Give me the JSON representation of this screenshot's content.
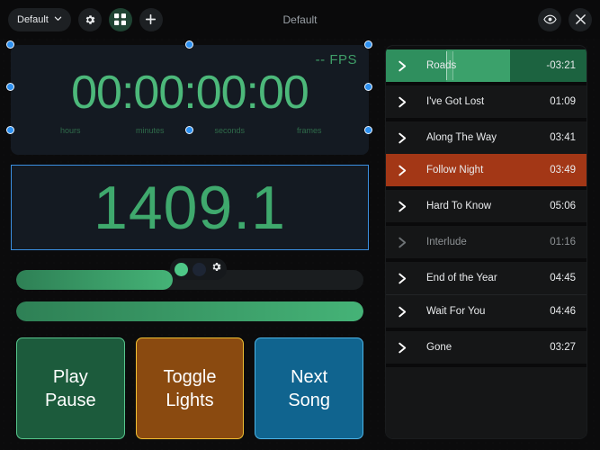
{
  "window": {
    "title": "Default"
  },
  "topbar": {
    "preset_label": "Default",
    "preset_chevron_icon": "chevron-down-icon",
    "settings_icon": "gear-icon",
    "grid_icon": "grid-icon",
    "add_icon": "plus-icon",
    "preview_icon": "eye-icon",
    "close_icon": "close-icon"
  },
  "timecode": {
    "fps_label": "-- FPS",
    "value": "00:00:00:00",
    "units": [
      "hours",
      "minutes",
      "seconds",
      "frames"
    ]
  },
  "value_display": {
    "value": "1409.1",
    "selected": true
  },
  "sliders": [
    {
      "name": "slider-primary",
      "percent": 45
    },
    {
      "name": "slider-secondary",
      "percent": 100
    }
  ],
  "slider_popup": {
    "swatch_green": "#4ec787",
    "swatch_dark": "#1d2534",
    "settings_icon": "gear-icon"
  },
  "buttons": [
    {
      "line1": "Play",
      "line2": "Pause",
      "bg": "#1c5b3c",
      "border": "#57c68d"
    },
    {
      "line1": "Toggle",
      "line2": "Lights",
      "bg": "#8a4a10",
      "border": "#f0c033"
    },
    {
      "line1": "Next",
      "line2": "Song",
      "bg": "#10648f",
      "border": "#4db5e8"
    }
  ],
  "playlist": {
    "tracks": [
      {
        "name": "Roads",
        "time": "-03:21",
        "state": "playing",
        "progress_pct": 30,
        "mid_start_pct": 30,
        "mid_end_pct": 62,
        "cursor_pct": 30
      },
      {
        "name": "I've Got Lost",
        "time": "01:09",
        "state": "normal"
      },
      {
        "name": "Along The Way",
        "time": "03:41",
        "state": "normal"
      },
      {
        "name": "Follow Night",
        "time": "03:49",
        "state": "selected"
      },
      {
        "name": "Hard To Know",
        "time": "05:06",
        "state": "normal"
      },
      {
        "name": "Interlude",
        "time": "01:16",
        "state": "dim"
      },
      {
        "name": "End of the Year",
        "time": "04:45",
        "state": "normal"
      },
      {
        "name": "Wait For You",
        "time": "04:46",
        "state": "normal"
      },
      {
        "name": "Gone",
        "time": "03:27",
        "state": "normal"
      }
    ]
  },
  "colors": {
    "accent_green": "#4cb87a",
    "selection_blue": "#2d90f0",
    "selected_row": "#a33716",
    "playing_row": "#1c6340"
  }
}
